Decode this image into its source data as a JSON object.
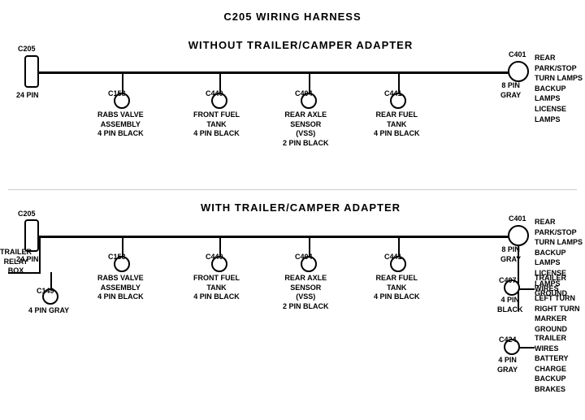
{
  "title": "C205 WIRING HARNESS",
  "top_section": {
    "label": "WITHOUT  TRAILER/CAMPER  ADAPTER",
    "left_connector": {
      "id": "C205",
      "pin_label": "24 PIN"
    },
    "right_connector": {
      "id": "C401",
      "pin_label": "8 PIN\nGRAY",
      "description": "REAR PARK/STOP\nTURN LAMPS\nBACKUP LAMPS\nLICENSE LAMPS"
    },
    "sub_connectors": [
      {
        "id": "C158",
        "label": "RABS VALVE\nASSEMBLY\n4 PIN BLACK"
      },
      {
        "id": "C440",
        "label": "FRONT FUEL\nTANK\n4 PIN BLACK"
      },
      {
        "id": "C404",
        "label": "REAR AXLE\nSENSOR\n(VSS)\n2 PIN BLACK"
      },
      {
        "id": "C441",
        "label": "REAR FUEL\nTANK\n4 PIN BLACK"
      }
    ]
  },
  "bottom_section": {
    "label": "WITH  TRAILER/CAMPER  ADAPTER",
    "left_connector": {
      "id": "C205",
      "pin_label": "24 PIN"
    },
    "trailer_relay": {
      "label": "TRAILER\nRELAY\nBOX"
    },
    "c149": {
      "id": "C149",
      "label": "4 PIN GRAY"
    },
    "right_connector": {
      "id": "C401",
      "pin_label": "8 PIN\nGRAY",
      "description": "REAR PARK/STOP\nTURN LAMPS\nBACKUP LAMPS\nLICENSE LAMPS\nGROUND"
    },
    "sub_connectors": [
      {
        "id": "C158",
        "label": "RABS VALVE\nASSEMBLY\n4 PIN BLACK"
      },
      {
        "id": "C440",
        "label": "FRONT FUEL\nTANK\n4 PIN BLACK"
      },
      {
        "id": "C404",
        "label": "REAR AXLE\nSENSOR\n(VSS)\n2 PIN BLACK"
      },
      {
        "id": "C441",
        "label": "REAR FUEL\nTANK\n4 PIN BLACK"
      }
    ],
    "extra_connectors": [
      {
        "id": "C407",
        "pin_label": "4 PIN\nBLACK",
        "description": "TRAILER WIRES\nLEFT TURN\nRIGHT TURN\nMARKER\nGROUND"
      },
      {
        "id": "C424",
        "pin_label": "4 PIN\nGRAY",
        "description": "TRAILER WIRES\nBATTERY CHARGE\nBACKUP\nBRAKES"
      }
    ]
  }
}
